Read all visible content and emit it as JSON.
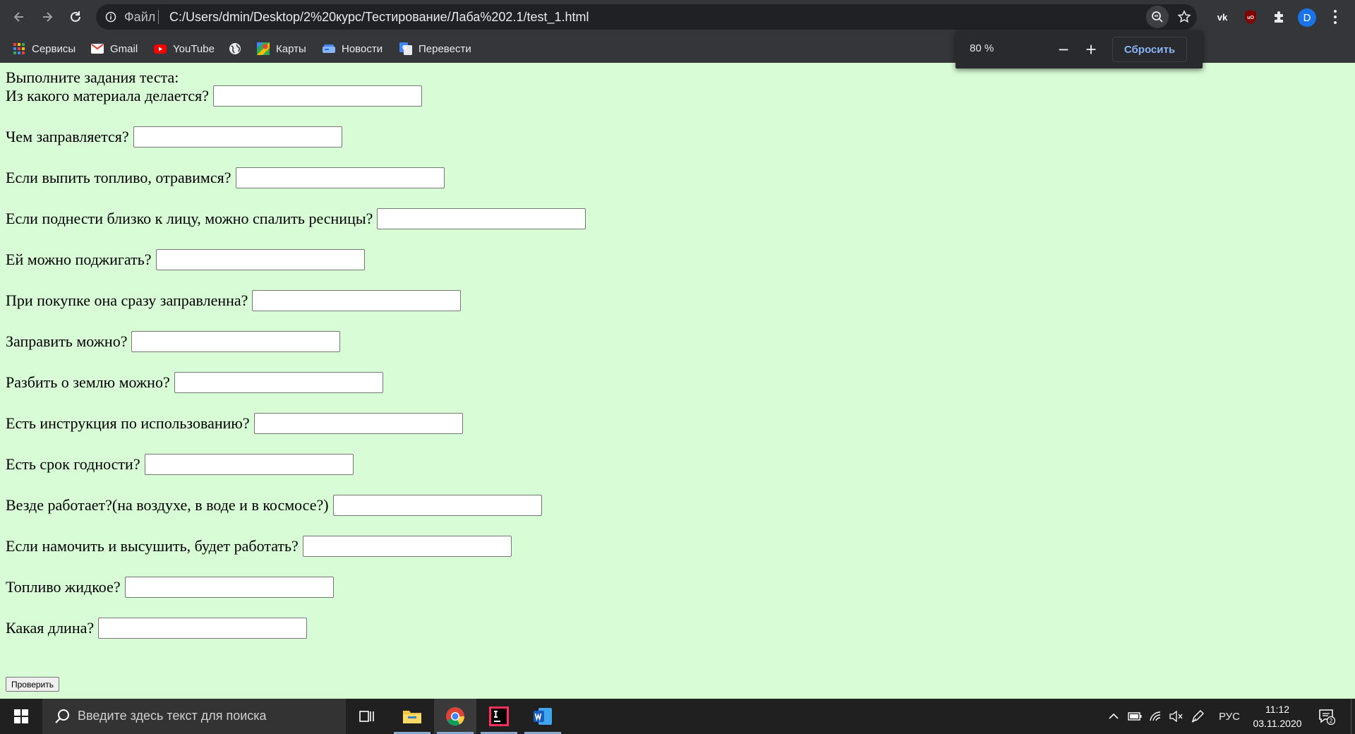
{
  "browser": {
    "site_label": "Файл",
    "url": "C:/Users/dmin/Desktop/2%20курс/Тестирование/Лаба%202.1/test_1.html",
    "profile_initial": "D"
  },
  "bookmarks": [
    {
      "label": "Сервисы",
      "icon": "apps-grid-icon"
    },
    {
      "label": "Gmail",
      "icon": "gmail-icon"
    },
    {
      "label": "YouTube",
      "icon": "youtube-icon"
    },
    {
      "label": "",
      "icon": "globe-icon"
    },
    {
      "label": "Карты",
      "icon": "maps-icon"
    },
    {
      "label": "Новости",
      "icon": "news-icon"
    },
    {
      "label": "Перевести",
      "icon": "translate-icon"
    }
  ],
  "zoom_popup": {
    "level": "80 %",
    "minus": "−",
    "plus": "+",
    "reset_label": "Сбросить"
  },
  "page": {
    "intro": "Выполните задания теста:",
    "questions": [
      {
        "label": "Из какого материала делается?",
        "value": ""
      },
      {
        "label": "Чем заправляется?",
        "value": ""
      },
      {
        "label": "Если выпить топливо, отравимся?",
        "value": ""
      },
      {
        "label": "Если поднести близко к лицу, можно спалить ресницы?",
        "value": ""
      },
      {
        "label": "Ей можно поджигать?",
        "value": ""
      },
      {
        "label": "При покупке она сразу заправленна?",
        "value": ""
      },
      {
        "label": "Заправить можно?",
        "value": ""
      },
      {
        "label": "Разбить о землю можно?",
        "value": ""
      },
      {
        "label": "Есть инструкция по использованию?",
        "value": ""
      },
      {
        "label": "Есть срок годности?",
        "value": ""
      },
      {
        "label": "Везде работает?(на воздухе, в воде и в космосе?)",
        "value": ""
      },
      {
        "label": "Если намочить и высушить, будет работать?",
        "value": ""
      },
      {
        "label": "Топливо жидкое?",
        "value": ""
      },
      {
        "label": "Какая длина?",
        "value": ""
      }
    ],
    "submit_label": "Проверить"
  },
  "taskbar": {
    "search_placeholder": "Введите здесь текст для поиска",
    "language": "РУС",
    "time": "11:12",
    "date": "03.11.2020",
    "notifications_count": "2"
  },
  "colors": {
    "page_background": "#d8fcd6",
    "browser_chrome": "#35363a",
    "taskbar": "#202020",
    "accent_link": "#8ab4f8"
  }
}
